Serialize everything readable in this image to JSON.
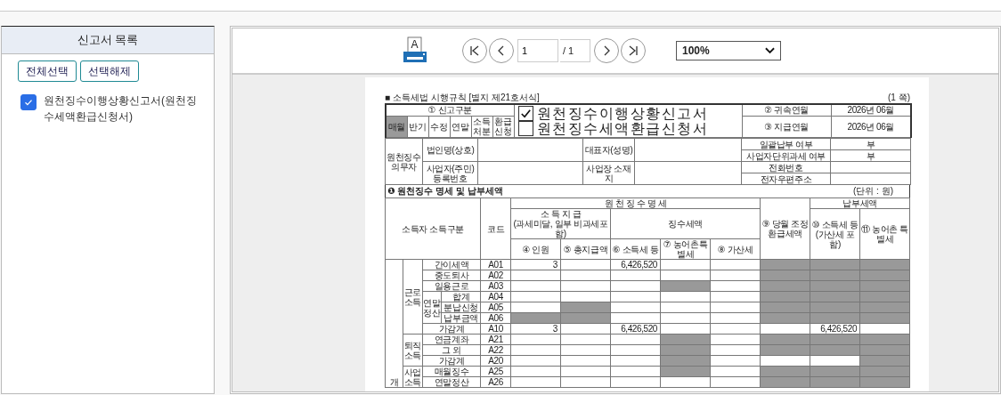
{
  "sidebar": {
    "title": "신고서 목록",
    "buttons": [
      "전체선택",
      "선택해제"
    ],
    "items": [
      {
        "label": "원천징수이행상황신고서(원천징수세액환급신청서)",
        "checked": true
      }
    ]
  },
  "toolbar": {
    "print_glyph": "A",
    "page": "1",
    "page_total": "/ 1",
    "zoom": "100%"
  },
  "form": {
    "rule": "■ 소득세법 시행규칙 [별지 제21호서식]",
    "page_no": "(1 쪽)",
    "type_label": "① 신고구분",
    "types": [
      {
        "label": "매월",
        "selected": true
      },
      {
        "label": "반기",
        "selected": false
      },
      {
        "label": "수정",
        "selected": false
      },
      {
        "label": "연말",
        "selected": false
      },
      {
        "label": "소득처분",
        "selected": false
      },
      {
        "label": "환급신청",
        "selected": false
      }
    ],
    "titles": [
      {
        "label": "원천징수이행상황신고서",
        "checked": true
      },
      {
        "label": "원천징수세액환급신청서",
        "checked": false
      }
    ],
    "dates": [
      {
        "label": "② 귀속연월",
        "value": "2026년 06월"
      },
      {
        "label": "③ 지급연월",
        "value": "2026년 06월"
      }
    ],
    "payer_label": "원천징수의무자",
    "fields": {
      "corp": "법인명(상호)",
      "rep": "대표자(성명)",
      "regno": "사업자(주민)등록번호",
      "addr": "사업장 소재지"
    },
    "flags": [
      {
        "label": "일괄납부 여부",
        "value": "부"
      },
      {
        "label": "사업자단위과세 여부",
        "value": "부"
      },
      {
        "label": "전화번호"
      },
      {
        "label": "전자우편주소"
      }
    ],
    "section_title": "❶ 원천징수 명세 및 납부세액",
    "unit": "(단위 : 원)",
    "headers": {
      "category": "소득자 소득구분",
      "code": "코드",
      "detail": "원 천 징 수 명 세",
      "paid": "소 득 지 급",
      "paid_note": "(과세미달, 일부 비과세포함)",
      "collected": "징수세액",
      "refund": "⑨ 당월 조정 환급세액",
      "payable": "납부세액",
      "columns": [
        "④ 인원",
        "⑤ 총지급액",
        "⑥ 소득세 등",
        "⑦ 농어촌특별세",
        "⑧ 가산세"
      ],
      "payable_columns": [
        "⑩ 소득세 등 (가산세 포함)",
        "⑪ 농어촌 특별세"
      ]
    },
    "sections": [
      {
        "label": "개",
        "groups": [
          {
            "label": "근로소득",
            "items": [
              {
                "name": "간이세액",
                "code": "A01",
                "cells": [
                  {
                    "text": "3",
                    "shaded": false
                  },
                  {
                    "shaded": false
                  },
                  {
                    "text": "6,426,520",
                    "shaded": false
                  },
                  {
                    "shaded": false
                  },
                  {
                    "shaded": false
                  },
                  {
                    "shaded": true
                  },
                  {
                    "shaded": true
                  },
                  {
                    "shaded": true
                  }
                ]
              },
              {
                "name": "중도퇴사",
                "code": "A02",
                "cells": [
                  {
                    "shaded": false
                  },
                  {
                    "shaded": false
                  },
                  {
                    "shaded": false
                  },
                  {
                    "shaded": false
                  },
                  {
                    "shaded": false
                  },
                  {
                    "shaded": true
                  },
                  {
                    "shaded": true
                  },
                  {
                    "shaded": true
                  }
                ]
              },
              {
                "name": "일용근로",
                "code": "A03",
                "cells": [
                  {
                    "shaded": false
                  },
                  {
                    "shaded": false
                  },
                  {
                    "shaded": false
                  },
                  {
                    "shaded": true
                  },
                  {
                    "shaded": false
                  },
                  {
                    "shaded": true
                  },
                  {
                    "shaded": true
                  },
                  {
                    "shaded": true
                  }
                ]
              },
              {
                "label": "연말정산",
                "children": [
                  {
                    "name": "합계",
                    "code": "A04",
                    "cells": [
                      {
                        "shaded": false
                      },
                      {
                        "shaded": false
                      },
                      {
                        "shaded": false
                      },
                      {
                        "shaded": false
                      },
                      {
                        "shaded": false
                      },
                      {
                        "shaded": true
                      },
                      {
                        "shaded": true
                      },
                      {
                        "shaded": true
                      }
                    ]
                  },
                  {
                    "name": "분납신청",
                    "code": "A05",
                    "cells": [
                      {
                        "shaded": false
                      },
                      {
                        "shaded": true
                      },
                      {
                        "shaded": false
                      },
                      {
                        "shaded": false
                      },
                      {
                        "shaded": false
                      },
                      {
                        "shaded": true
                      },
                      {
                        "shaded": true
                      },
                      {
                        "shaded": true
                      }
                    ]
                  },
                  {
                    "name": "납부금액",
                    "code": "A06",
                    "cells": [
                      {
                        "shaded": true
                      },
                      {
                        "shaded": true
                      },
                      {
                        "shaded": false
                      },
                      {
                        "shaded": false
                      },
                      {
                        "shaded": false
                      },
                      {
                        "shaded": true
                      },
                      {
                        "shaded": true
                      },
                      {
                        "shaded": true
                      }
                    ]
                  }
                ]
              },
              {
                "name": "가감계",
                "code": "A10",
                "cells": [
                  {
                    "text": "3",
                    "shaded": false
                  },
                  {
                    "shaded": false
                  },
                  {
                    "text": "6,426,520",
                    "shaded": false
                  },
                  {
                    "shaded": false
                  },
                  {
                    "shaded": false
                  },
                  {
                    "shaded": false
                  },
                  {
                    "text": "6,426,520",
                    "shaded": false
                  },
                  {
                    "shaded": false
                  }
                ]
              }
            ]
          },
          {
            "label": "퇴직소득",
            "items": [
              {
                "name": "연금계좌",
                "code": "A21",
                "cells": [
                  {
                    "shaded": false
                  },
                  {
                    "shaded": false
                  },
                  {
                    "shaded": false
                  },
                  {
                    "shaded": true
                  },
                  {
                    "shaded": false
                  },
                  {
                    "shaded": true
                  },
                  {
                    "shaded": true
                  },
                  {
                    "shaded": true
                  }
                ]
              },
              {
                "name": "그 외",
                "code": "A22",
                "cells": [
                  {
                    "shaded": false
                  },
                  {
                    "shaded": false
                  },
                  {
                    "shaded": false
                  },
                  {
                    "shaded": true
                  },
                  {
                    "shaded": false
                  },
                  {
                    "shaded": true
                  },
                  {
                    "shaded": true
                  },
                  {
                    "shaded": true
                  }
                ]
              },
              {
                "name": "가감계",
                "code": "A20",
                "cells": [
                  {
                    "shaded": false
                  },
                  {
                    "shaded": false
                  },
                  {
                    "shaded": false
                  },
                  {
                    "shaded": true
                  },
                  {
                    "shaded": false
                  },
                  {
                    "shaded": false
                  },
                  {
                    "shaded": false
                  },
                  {
                    "shaded": true
                  }
                ]
              }
            ]
          },
          {
            "label": "사업소득",
            "items": [
              {
                "name": "매월징수",
                "code": "A25",
                "cells": [
                  {
                    "shaded": false
                  },
                  {
                    "shaded": false
                  },
                  {
                    "shaded": false
                  },
                  {
                    "shaded": true
                  },
                  {
                    "shaded": false
                  },
                  {
                    "shaded": true
                  },
                  {
                    "shaded": true
                  },
                  {
                    "shaded": true
                  }
                ]
              },
              {
                "name": "연말정산",
                "code": "A26",
                "cells": [
                  {
                    "shaded": false
                  },
                  {
                    "shaded": false
                  },
                  {
                    "shaded": false
                  },
                  {
                    "shaded": false
                  },
                  {
                    "shaded": false
                  },
                  {
                    "shaded": true
                  },
                  {
                    "shaded": true
                  },
                  {
                    "shaded": true
                  }
                ]
              }
            ]
          }
        ]
      }
    ]
  }
}
